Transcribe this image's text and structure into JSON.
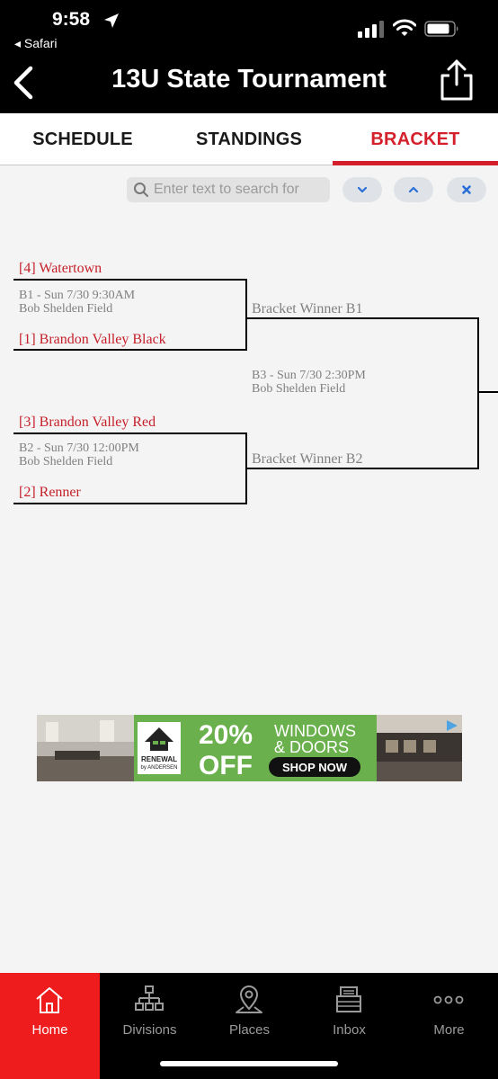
{
  "status_bar": {
    "time": "9:58",
    "back_app": "◂ Safari",
    "icons": [
      "location-arrow-icon",
      "cellular-signal-icon",
      "wifi-icon",
      "battery-icon"
    ]
  },
  "header": {
    "title": "13U State Tournament",
    "back_icon": "chevron-left-icon",
    "share_icon": "share-icon"
  },
  "tabs": [
    {
      "label": "SCHEDULE",
      "active": false
    },
    {
      "label": "STANDINGS",
      "active": false
    },
    {
      "label": "BRACKET",
      "active": true
    }
  ],
  "search": {
    "placeholder": "Enter text to search for",
    "value": "",
    "buttons": [
      "chevron-down-icon",
      "chevron-up-icon",
      "close-icon"
    ]
  },
  "bracket": {
    "game_b1": {
      "team_top": "[4] Watertown",
      "team_bottom": "[1] Brandon Valley Black",
      "info_line1": "B1 - Sun 7/30 9:30AM",
      "info_line2": "Bob Shelden Field",
      "winner": "Bracket Winner B1"
    },
    "game_b2": {
      "team_top": "[3] Brandon Valley Red",
      "team_bottom": "[2] Renner",
      "info_line1": "B2 - Sun 7/30 12:00PM",
      "info_line2": "Bob Shelden Field",
      "winner": "Bracket Winner B2"
    },
    "game_b3": {
      "info_line1": "B3 - Sun 7/30 2:30PM",
      "info_line2": "Bob Shelden Field"
    }
  },
  "ad": {
    "brand_line1": "RENEWAL",
    "brand_line2": "by ANDERSEN",
    "headline_percent": "20%",
    "headline_off": "OFF",
    "offer_line1": "WINDOWS",
    "offer_line2": "& DOORS",
    "cta": "SHOP NOW",
    "brand_green": "#6ab04c"
  },
  "bottom_nav": [
    {
      "label": "Home",
      "icon": "home-icon",
      "active": true
    },
    {
      "label": "Divisions",
      "icon": "divisions-icon",
      "active": false
    },
    {
      "label": "Places",
      "icon": "map-pin-icon",
      "active": false
    },
    {
      "label": "Inbox",
      "icon": "inbox-icon",
      "active": false
    },
    {
      "label": "More",
      "icon": "more-icon",
      "active": false
    }
  ],
  "colors": {
    "accent": "#d4202a",
    "nav_active": "#ee1c1c",
    "team_text": "#c5202a",
    "muted_text": "#808080"
  }
}
